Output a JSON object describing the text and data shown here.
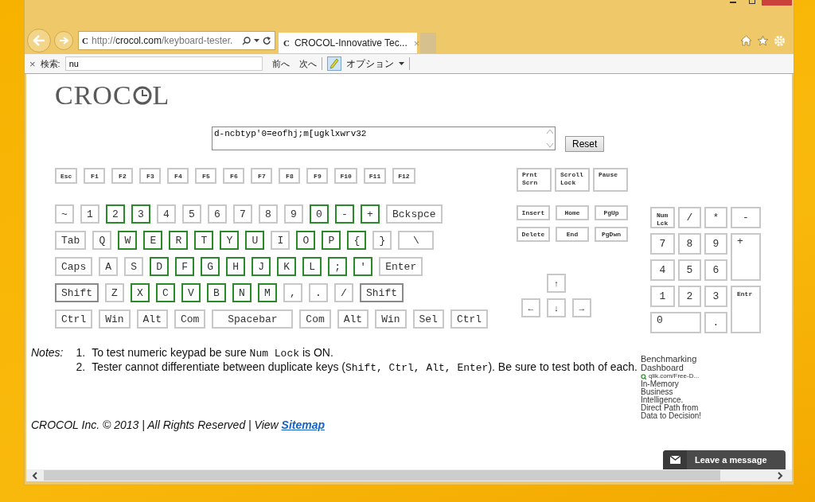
{
  "browser": {
    "url": {
      "favicon": "C",
      "scheme": "http://",
      "host": "crocol.com",
      "path": "/keyboard-tester."
    },
    "tabs": [
      {
        "favicon": "C",
        "title": "CROCOL-Innovative Tec...",
        "close": "×",
        "selected": true
      }
    ],
    "find_bar": {
      "close": "×",
      "label": "検索:",
      "value": "nu",
      "prev": "前へ",
      "next": "次へ",
      "highlight_on": true,
      "options": "オプション"
    }
  },
  "page": {
    "logo": {
      "before": "CROC",
      "after": "L"
    },
    "input": {
      "value": "d-ncbtyp'0=eofhj;m[ugklxwrv32"
    },
    "reset": "Reset",
    "function_row": [
      {
        "label": "Esc",
        "tested": false
      },
      {
        "label": "F1",
        "tested": false
      },
      {
        "label": "F2",
        "tested": false
      },
      {
        "label": "F3",
        "tested": false
      },
      {
        "label": "F4",
        "tested": false
      },
      {
        "label": "F5",
        "tested": false
      },
      {
        "label": "F6",
        "tested": false
      },
      {
        "label": "F7",
        "tested": false
      },
      {
        "label": "F8",
        "tested": false
      },
      {
        "label": "F9",
        "tested": false
      },
      {
        "label": "F10",
        "tested": false
      },
      {
        "label": "F11",
        "tested": false
      },
      {
        "label": "F12",
        "tested": false
      }
    ],
    "key_rows": [
      {
        "keys": [
          {
            "label": "~",
            "tested": false
          },
          {
            "label": "1",
            "tested": false
          },
          {
            "label": "2",
            "tested": true
          },
          {
            "label": "3",
            "tested": true
          },
          {
            "label": "4",
            "tested": false
          },
          {
            "label": "5",
            "tested": false
          },
          {
            "label": "6",
            "tested": false
          },
          {
            "label": "7",
            "tested": false
          },
          {
            "label": "8",
            "tested": false
          },
          {
            "label": "9",
            "tested": false
          },
          {
            "label": "0",
            "tested": true
          },
          {
            "label": "-",
            "tested": true
          },
          {
            "label": "+",
            "tested": true
          },
          {
            "label": "Bckspce",
            "tested": false
          }
        ]
      },
      {
        "keys": [
          {
            "label": "Tab",
            "tested": false
          },
          {
            "label": "Q",
            "tested": false
          },
          {
            "label": "W",
            "tested": true
          },
          {
            "label": "E",
            "tested": true
          },
          {
            "label": "R",
            "tested": true
          },
          {
            "label": "T",
            "tested": true
          },
          {
            "label": "Y",
            "tested": true
          },
          {
            "label": "U",
            "tested": true
          },
          {
            "label": "I",
            "tested": false
          },
          {
            "label": "O",
            "tested": true
          },
          {
            "label": "P",
            "tested": true
          },
          {
            "label": "{",
            "tested": true
          },
          {
            "label": "}",
            "tested": false
          },
          {
            "label": "\\",
            "tested": false,
            "kind": "wide"
          }
        ]
      },
      {
        "keys": [
          {
            "label": "Caps",
            "tested": false
          },
          {
            "label": "A",
            "tested": false
          },
          {
            "label": "S",
            "tested": false
          },
          {
            "label": "D",
            "tested": true
          },
          {
            "label": "F",
            "tested": true
          },
          {
            "label": "G",
            "tested": true
          },
          {
            "label": "H",
            "tested": true
          },
          {
            "label": "J",
            "tested": true
          },
          {
            "label": "K",
            "tested": true
          },
          {
            "label": "L",
            "tested": true
          },
          {
            "label": ";",
            "tested": true
          },
          {
            "label": "'",
            "tested": true
          },
          {
            "label": "Enter",
            "tested": false
          }
        ]
      },
      {
        "keys": [
          {
            "label": "Shift",
            "tested": false,
            "held": true
          },
          {
            "label": "Z",
            "tested": false
          },
          {
            "label": "X",
            "tested": true
          },
          {
            "label": "C",
            "tested": true
          },
          {
            "label": "V",
            "tested": true
          },
          {
            "label": "B",
            "tested": true
          },
          {
            "label": "N",
            "tested": true
          },
          {
            "label": "M",
            "tested": true
          },
          {
            "label": ",",
            "tested": false
          },
          {
            "label": ".",
            "tested": false
          },
          {
            "label": "/",
            "tested": false
          },
          {
            "label": "Shift",
            "tested": false,
            "held": true
          }
        ]
      },
      {
        "keys": [
          {
            "label": "Ctrl",
            "tested": false
          },
          {
            "label": "Win",
            "tested": false
          },
          {
            "label": "Alt",
            "tested": false
          },
          {
            "label": "Com",
            "tested": false
          },
          {
            "label": "Spacebar",
            "tested": false,
            "kind": "space"
          },
          {
            "label": "Com",
            "tested": false
          },
          {
            "label": "Alt",
            "tested": false
          },
          {
            "label": "Win",
            "tested": false
          },
          {
            "label": "Sel",
            "tested": false
          },
          {
            "label": "Ctrl",
            "tested": false
          }
        ]
      }
    ],
    "system_keys": [
      {
        "label": "Prnt Scrn",
        "tested": false
      },
      {
        "label": "Scroll Lock",
        "tested": false
      },
      {
        "label": "Pause",
        "tested": false
      }
    ],
    "nav_rows": [
      {
        "keys": [
          {
            "label": "Insert",
            "tested": false
          },
          {
            "label": "Home",
            "tested": false
          },
          {
            "label": "PgUp",
            "tested": false
          }
        ]
      },
      {
        "keys": [
          {
            "label": "Delete",
            "tested": false
          },
          {
            "label": "End",
            "tested": false
          },
          {
            "label": "PgDwn",
            "tested": false
          }
        ]
      }
    ],
    "arrow_rows": [
      {
        "keys": [
          {
            "label": "↑",
            "tested": false
          }
        ]
      },
      {
        "keys": [
          {
            "label": "←",
            "tested": false
          },
          {
            "label": "↓",
            "tested": false
          },
          {
            "label": "→",
            "tested": false
          }
        ]
      }
    ],
    "numpad": [
      {
        "label": "Num Lck",
        "kind": "label",
        "tested": false
      },
      {
        "label": "/",
        "kind": "key",
        "tested": false
      },
      {
        "label": "*",
        "kind": "key",
        "tested": false
      },
      {
        "label": "-",
        "kind": "key",
        "tested": false
      },
      {
        "label": "7",
        "kind": "key",
        "tested": false
      },
      {
        "label": "8",
        "kind": "key",
        "tested": false
      },
      {
        "label": "9",
        "kind": "key",
        "tested": false
      },
      {
        "label": "+",
        "kind": "tall",
        "tested": false
      },
      {
        "label": "4",
        "kind": "key",
        "tested": false
      },
      {
        "label": "5",
        "kind": "key",
        "tested": false
      },
      {
        "label": "6",
        "kind": "key",
        "tested": false
      },
      {
        "label": "1",
        "kind": "key",
        "tested": false
      },
      {
        "label": "2",
        "kind": "key",
        "tested": false
      },
      {
        "label": "3",
        "kind": "key",
        "tested": false
      },
      {
        "label": "Entr",
        "kind": "enter",
        "tested": false
      },
      {
        "label": "0",
        "kind": "wide",
        "tested": false
      },
      {
        "label": ".",
        "kind": "key",
        "tested": false
      }
    ],
    "notes": {
      "label": "Notes:",
      "items": [
        {
          "number": "1.",
          "parts": [
            {
              "text": "To test numeric keypad be sure ",
              "kind": "text"
            },
            {
              "text": "Num Lock",
              "kind": "code"
            },
            {
              "text": " is ON.",
              "kind": "text"
            }
          ]
        },
        {
          "number": "2.",
          "parts": [
            {
              "text": "Tester cannot differentiate between duplicate keys (",
              "kind": "text"
            },
            {
              "text": "Shift, Ctrl, Alt, Enter",
              "kind": "code"
            },
            {
              "text": "). Be sure to test both of each.",
              "kind": "text"
            }
          ]
        }
      ]
    },
    "footer": {
      "text": "CROCOL Inc. © 2013 | All Rights Reserved | View",
      "link": "Sitemap"
    },
    "ad": {
      "title": "Benchmarking Dashboard",
      "source": "qlik.com/Free-D...",
      "body": "In-Memory Business Intelligence. Direct Path from Data to Decision!"
    },
    "chat_button": "Leave a message"
  }
}
